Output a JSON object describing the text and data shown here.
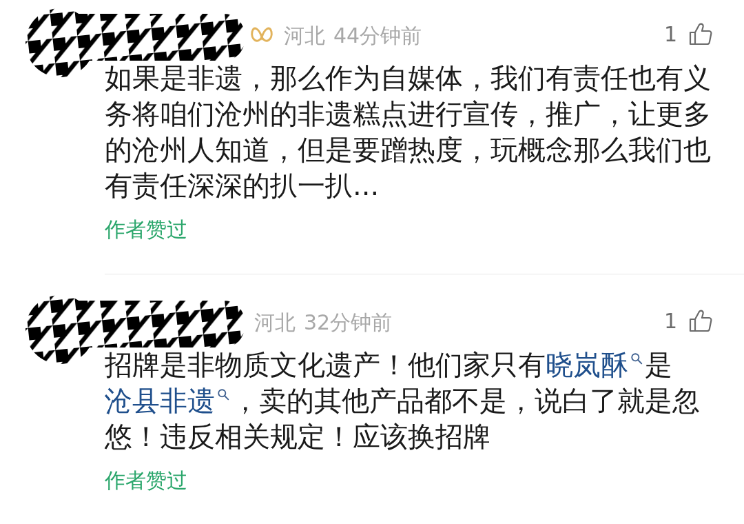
{
  "comments": [
    {
      "author_redacted": true,
      "badge": true,
      "location": "河北",
      "time": "44分钟前",
      "likes": "1",
      "body": [
        {
          "kind": "text",
          "text": "如果是非遗，那么作为自媒体，我们有责任也有义务将咱们沧州的非遗糕点进行宣传，推广，让更多的沧州人知道，但是要蹭热度，玩概念那么我们也有责任深深的扒一扒..."
        }
      ],
      "author_note": "作者赞过"
    },
    {
      "author_redacted": true,
      "badge": false,
      "location": "河北",
      "time": "32分钟前",
      "likes": "1",
      "body": [
        {
          "kind": "text",
          "text": "招牌是非物质文化遗产！他们家只有"
        },
        {
          "kind": "link",
          "text": "晓岚酥"
        },
        {
          "kind": "text",
          "text": "是"
        },
        {
          "kind": "link",
          "text": "沧县非遗"
        },
        {
          "kind": "text",
          "text": "，卖的其他产品都不是，说白了就是忽悠！违反相关规定！应该换招牌"
        }
      ],
      "author_note": "作者赞过"
    }
  ]
}
